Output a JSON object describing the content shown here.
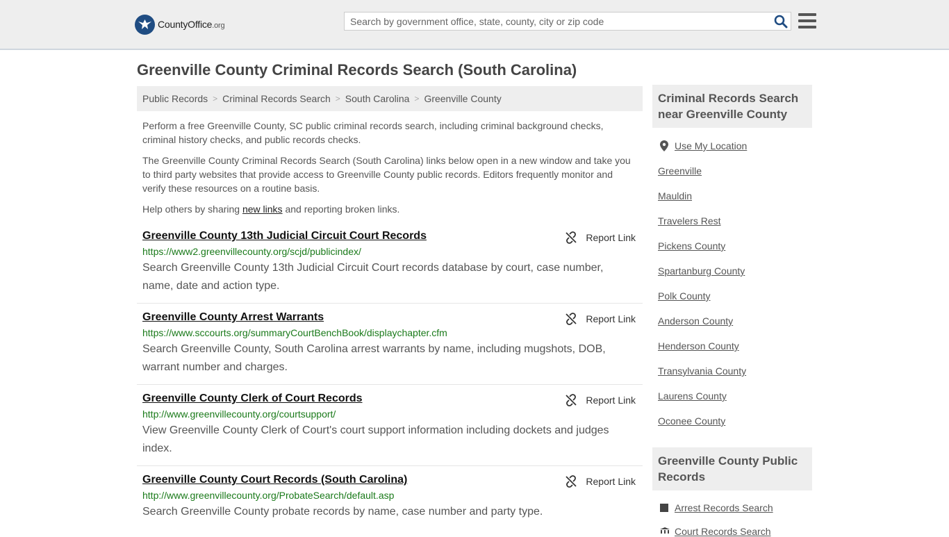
{
  "header": {
    "logo_text_main": "CountyOffice",
    "logo_text_org": ".org",
    "search_placeholder": "Search by government office, state, county, city or zip code",
    "colors": {
      "brand": "#1f4c82",
      "link_green": "#1a7a1a"
    }
  },
  "page": {
    "title": "Greenville County Criminal Records Search (South Carolina)",
    "breadcrumb": [
      "Public Records",
      "Criminal Records Search",
      "South Carolina",
      "Greenville County"
    ],
    "intro_1": "Perform a free Greenville County, SC public criminal records search, including criminal background checks, criminal history checks, and public records checks.",
    "intro_2": "The Greenville County Criminal Records Search (South Carolina) links below open in a new window and take you to third party websites that provide access to Greenville County public records. Editors frequently monitor and verify these resources on a routine basis.",
    "help_before": "Help others by sharing ",
    "help_link": "new links",
    "help_after": " and reporting broken links."
  },
  "results": [
    {
      "title": "Greenville County 13th Judicial Circuit Court Records",
      "url": "https://www2.greenvillecounty.org/scjd/publicindex/",
      "desc": "Search Greenville County 13th Judicial Circuit Court records database by court, case number, name, date and action type.",
      "report": "Report Link"
    },
    {
      "title": "Greenville County Arrest Warrants",
      "url": "https://www.sccourts.org/summaryCourtBenchBook/displaychapter.cfm",
      "desc": "Search Greenville County, South Carolina arrest warrants by name, including mugshots, DOB, warrant number and charges.",
      "report": "Report Link"
    },
    {
      "title": "Greenville County Clerk of Court Records",
      "url": "http://www.greenvillecounty.org/courtsupport/",
      "desc": "View Greenville County Clerk of Court's court support information including dockets and judges index.",
      "report": "Report Link"
    },
    {
      "title": "Greenville County Court Records (South Carolina)",
      "url": "http://www.greenvillecounty.org/ProbateSearch/default.asp",
      "desc": "Search Greenville County probate records by name, case number and party type.",
      "report": "Report Link"
    }
  ],
  "sidebar": {
    "nearby_heading": "Criminal Records Search near Greenville County",
    "use_location": "Use My Location",
    "nearby": [
      "Greenville",
      "Mauldin",
      "Travelers Rest",
      "Pickens County",
      "Spartanburg County",
      "Polk County",
      "Anderson County",
      "Henderson County",
      "Transylvania County",
      "Laurens County",
      "Oconee County"
    ],
    "public_heading": "Greenville County Public Records",
    "public_links": [
      "Arrest Records Search",
      "Court Records Search"
    ]
  }
}
